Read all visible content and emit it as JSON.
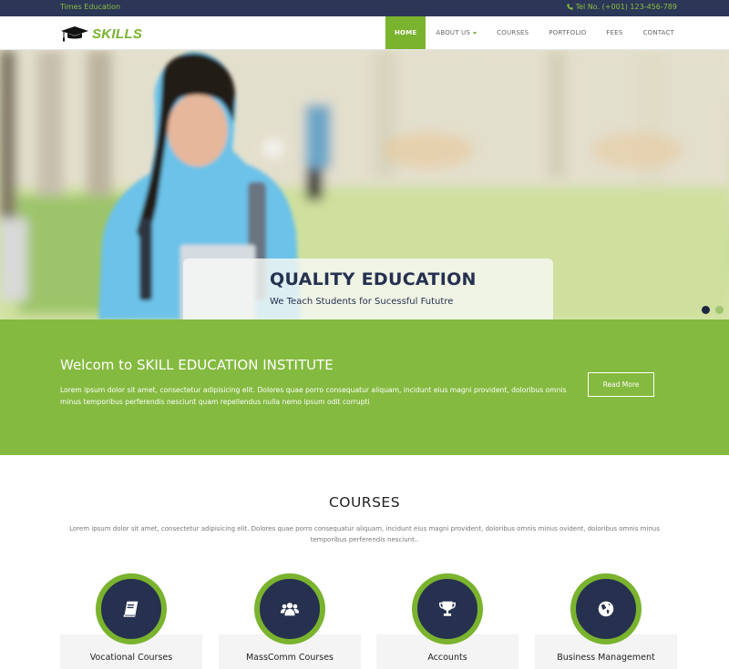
{
  "topbar": {
    "brand": "Times Education",
    "phone_icon": "phone-icon",
    "tel": "Tel No. (+001) 123-456-789"
  },
  "navbar": {
    "logo_icon": "graduation-cap-icon",
    "logo_text": "SKILLS",
    "items": [
      {
        "label": "HOME",
        "active": true
      },
      {
        "label": "ABOUT US",
        "dropdown": true
      },
      {
        "label": "COURSES"
      },
      {
        "label": "PORTFOLIO"
      },
      {
        "label": "FEES"
      },
      {
        "label": "CONTACT"
      }
    ]
  },
  "hero": {
    "title": "QUALITY EDUCATION",
    "subtitle": "We Teach Students for Sucessful Fututre",
    "slides": 2,
    "active_slide": 1
  },
  "welcome": {
    "title": "Welcom to SKILL EDUCATION INSTITUTE",
    "text": "Lorem ipsum dolor sit amet, consectetur adipisicing elit. Dolores quae porro consequatur aliquam, incidunt eius magni provident, doloribus omnis minus temporibus perferendis nesciunt quam repellendus nulla nemo ipsum odit corrupti",
    "button": "Read More"
  },
  "courses": {
    "title": "COURSES",
    "intro": "Lorem ipsum dolor sit amet, consectetur adipisicing elit. Dolores quae porro consequatur aliquam, incidunt eius magni provident, doloribus omnis minus ovident, doloribus omnis minus temporibus perferendis nesciunt..",
    "items": [
      {
        "label": "Vocational Courses",
        "icon": "book-icon"
      },
      {
        "label": "MassComm Courses",
        "icon": "users-icon"
      },
      {
        "label": "Accounts",
        "icon": "trophy-icon"
      },
      {
        "label": "Business Management",
        "icon": "globe-icon"
      }
    ]
  },
  "colors": {
    "accent_green": "#7ab32e",
    "navy": "#26304f",
    "topbar": "#2c3657",
    "welcome_bg": "#84ba3f"
  }
}
